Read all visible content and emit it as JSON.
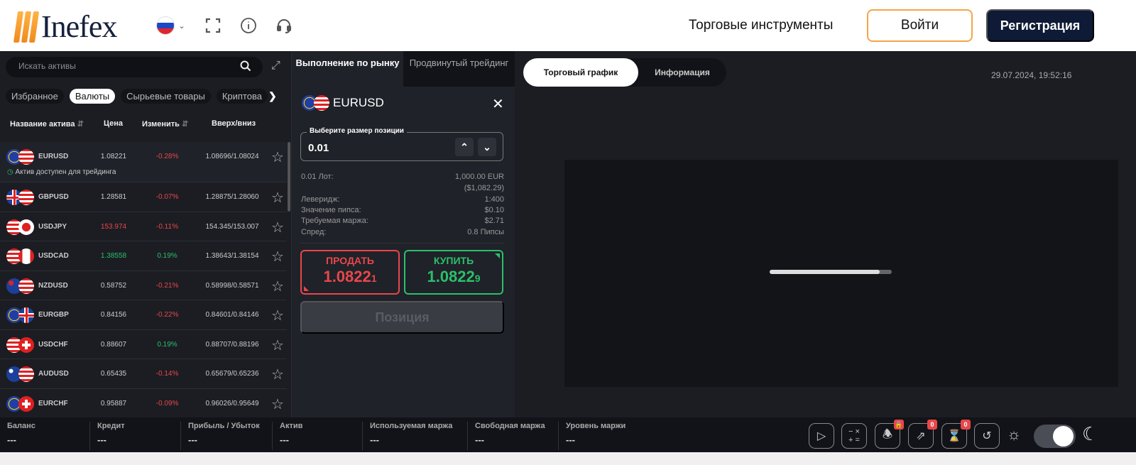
{
  "header": {
    "logo": "Inefex",
    "language": "ru",
    "nav_link": "Торговые инструменты",
    "login": "Войти",
    "register": "Регистрация"
  },
  "assets": {
    "search_placeholder": "Искать активы",
    "categories": [
      "Избранное",
      "Валюты",
      "Сырьевые товары",
      "Криптова"
    ],
    "columns": {
      "name": "Название актива",
      "price": "Цена",
      "change": "Изменить",
      "highlow": "Вверх/вниз"
    },
    "available_text": "Актив доступен для трейдинга",
    "rows": [
      {
        "symbol": "EURUSD",
        "price": "1.08221",
        "change": "-0.28%",
        "highlow": "1.08696/1.08024"
      },
      {
        "symbol": "GBPUSD",
        "price": "1.28581",
        "change": "-0.07%",
        "highlow": "1.28875/1.28060"
      },
      {
        "symbol": "USDJPY",
        "price": "153.974",
        "change": "-0.11%",
        "highlow": "154.345/153.007"
      },
      {
        "symbol": "USDCAD",
        "price": "1.38558",
        "change": "0.19%",
        "highlow": "1.38643/1.38154"
      },
      {
        "symbol": "NZDUSD",
        "price": "0.58752",
        "change": "-0.21%",
        "highlow": "0.58998/0.58571"
      },
      {
        "symbol": "EURGBP",
        "price": "0.84156",
        "change": "-0.22%",
        "highlow": "0.84601/0.84146"
      },
      {
        "symbol": "USDCHF",
        "price": "0.88607",
        "change": "0.19%",
        "highlow": "0.88707/0.88196"
      },
      {
        "symbol": "AUDUSD",
        "price": "0.65435",
        "change": "-0.14%",
        "highlow": "0.65679/0.65236"
      },
      {
        "symbol": "EURCHF",
        "price": "0.95887",
        "change": "-0.09%",
        "highlow": "0.96026/0.95649"
      }
    ]
  },
  "trade": {
    "tabs": [
      "Выполнение по рынку",
      "Продвинутый трейдинг"
    ],
    "symbol": "EURUSD",
    "size_label": "Выберите размер позиции",
    "size_value": "0.01",
    "info": [
      {
        "k": "0.01 Лот:",
        "v": "1,000.00 EUR"
      },
      {
        "k": "",
        "v": "($1,082.29)"
      },
      {
        "k": "Левeридж:",
        "v": "1:400"
      },
      {
        "k": "Значение пипса:",
        "v": "$0.10"
      },
      {
        "k": "Требуемая маржа:",
        "v": "$2.71"
      },
      {
        "k": "Спред:",
        "v": "0.8 Пипсы"
      }
    ],
    "sell_label": "ПРОДАТЬ",
    "sell_price": "1.0822",
    "sell_pip": "1",
    "buy_label": "КУПИТЬ",
    "buy_price": "1.0822",
    "buy_pip": "9",
    "position_button": "Позиция"
  },
  "chart": {
    "tabs": [
      "Торговый график",
      "Информация"
    ],
    "datetime": "29.07.2024, 19:52:16",
    "loading_progress": 0.9
  },
  "bottom": {
    "stats": [
      {
        "k": "Баланс",
        "v": "---"
      },
      {
        "k": "Кредит",
        "v": "---"
      },
      {
        "k": "Прибыль / Убыток",
        "v": "---"
      },
      {
        "k": "Актив",
        "v": "---"
      },
      {
        "k": "Используемая маржа",
        "v": "---"
      },
      {
        "k": "Свободная маржа",
        "v": "---"
      },
      {
        "k": "Уровень маржи",
        "v": "---"
      }
    ],
    "badges": {
      "orders": "0",
      "pending": "0"
    }
  }
}
